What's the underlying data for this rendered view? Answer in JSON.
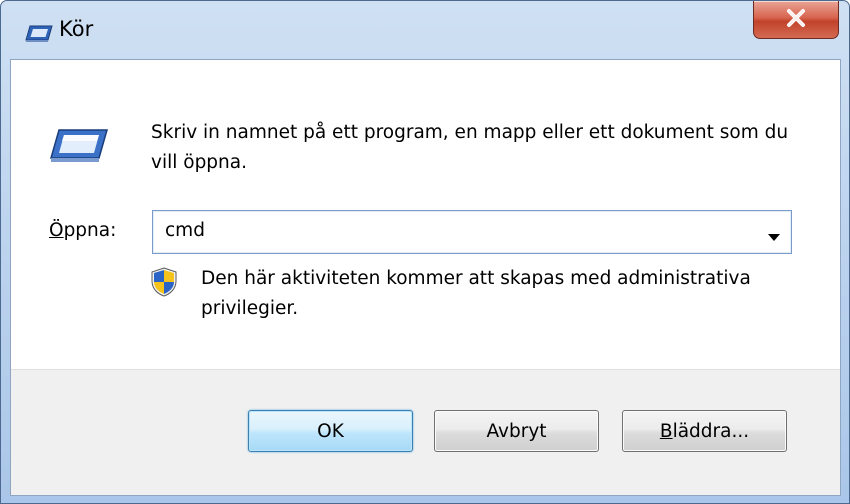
{
  "window": {
    "title": "Kör",
    "close_label": "X"
  },
  "main": {
    "description": "Skriv in namnet på ett program, en mapp eller ett dokument som du vill öppna.",
    "open_label_first": "Ö",
    "open_label_rest": "ppna:",
    "combo_value": "cmd",
    "admin_note": "Den här aktiviteten kommer att skapas med administrativa privilegier."
  },
  "buttons": {
    "ok": "OK",
    "cancel": "Avbryt",
    "browse_first": "B",
    "browse_rest": "läddra..."
  },
  "icons": {
    "title": "run-icon",
    "run": "run-icon",
    "shield": "uac-shield-icon",
    "dropdown": "chevron-down-icon",
    "close": "close-icon"
  },
  "colors": {
    "titlebar": "#bcd3ee",
    "close_button": "#c94a34",
    "default_button_border": "#3c7fb1",
    "footer": "#f0f0f0"
  }
}
